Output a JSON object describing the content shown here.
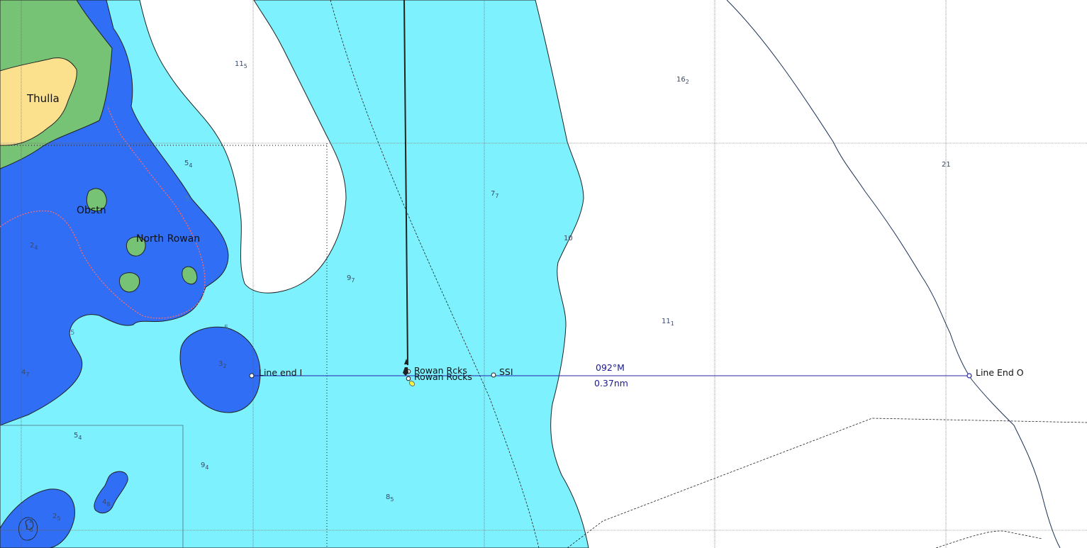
{
  "map": {
    "places": {
      "thulla": "Thulla",
      "obstn": "Obstn",
      "north_rowan": "North Rowan"
    },
    "depths": [
      {
        "main": "11",
        "sub": "5"
      },
      {
        "main": "16",
        "sub": "2"
      },
      {
        "main": "5",
        "sub": "4"
      },
      {
        "main": "7",
        "sub": "7"
      },
      {
        "main": "21",
        "sub": ""
      },
      {
        "main": "2",
        "sub": "4"
      },
      {
        "main": "9",
        "sub": "7"
      },
      {
        "main": "11",
        "sub": "1"
      },
      {
        "main": "3",
        "sub": "2"
      },
      {
        "main": "4",
        "sub": "7"
      },
      {
        "main": "5",
        "sub": "4"
      },
      {
        "main": "9",
        "sub": "4"
      },
      {
        "main": "8",
        "sub": "5"
      },
      {
        "main": "4",
        "sub": "8"
      },
      {
        "main": "2",
        "sub": "5"
      },
      {
        "main": "1",
        "sub": "6"
      },
      {
        "main": "2",
        "sub": ""
      }
    ],
    "contours": {
      "c5a": "5",
      "c10": "10",
      "c5b": "5",
      "c5c": "5"
    },
    "marks": {
      "rowan_rcks": "Rowan Rcks",
      "rowan_rocks": "Rowan Rocks",
      "ssi": "SSI",
      "line_end_i": "Line end I",
      "line_end_o": "Line End O"
    },
    "leg": {
      "bearing": "092°M",
      "distance": "0.37nm"
    },
    "colors": {
      "land": "#fbe08d",
      "intertidal": "#76c375",
      "shallow": "#2f6ef5",
      "medium": "#7df1fd",
      "deep": "#ffffff",
      "leg_line": "#2424aa"
    }
  }
}
